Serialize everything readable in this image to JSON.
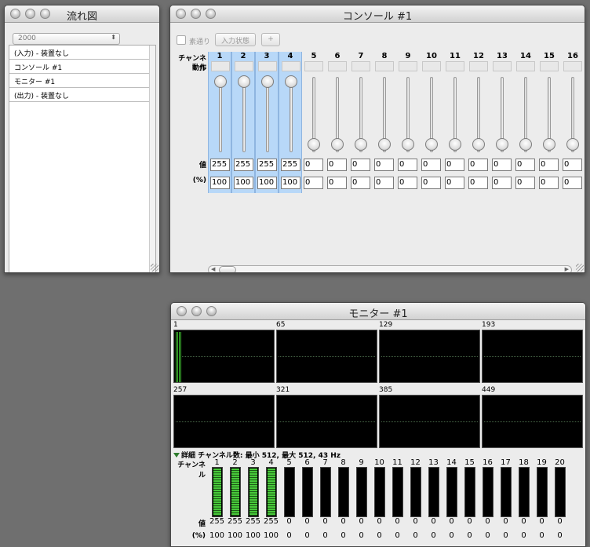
{
  "flow": {
    "title": "流れ図",
    "popup_value": "2000",
    "items": [
      "(入力) - 装置なし",
      "コンソール #1",
      "モニター #1",
      "(出力) - 装置なし"
    ]
  },
  "console": {
    "title": "コンソール #1",
    "bypass_label": "素通り",
    "input_state_button": "入力状態",
    "add_button": "+",
    "channel_label": "チャンネル",
    "action_label": "動作",
    "value_label": "値",
    "percent_label": "(%)",
    "channels": [
      {
        "num": "1",
        "value": "255",
        "percent": "100",
        "selected": true,
        "level": 1
      },
      {
        "num": "2",
        "value": "255",
        "percent": "100",
        "selected": true,
        "level": 1
      },
      {
        "num": "3",
        "value": "255",
        "percent": "100",
        "selected": true,
        "level": 1
      },
      {
        "num": "4",
        "value": "255",
        "percent": "100",
        "selected": true,
        "level": 1
      },
      {
        "num": "5",
        "value": "0",
        "percent": "0",
        "selected": false,
        "level": 0
      },
      {
        "num": "6",
        "value": "0",
        "percent": "0",
        "selected": false,
        "level": 0
      },
      {
        "num": "7",
        "value": "0",
        "percent": "0",
        "selected": false,
        "level": 0
      },
      {
        "num": "8",
        "value": "0",
        "percent": "0",
        "selected": false,
        "level": 0
      },
      {
        "num": "9",
        "value": "0",
        "percent": "0",
        "selected": false,
        "level": 0
      },
      {
        "num": "10",
        "value": "0",
        "percent": "0",
        "selected": false,
        "level": 0
      },
      {
        "num": "11",
        "value": "0",
        "percent": "0",
        "selected": false,
        "level": 0
      },
      {
        "num": "12",
        "value": "0",
        "percent": "0",
        "selected": false,
        "level": 0
      },
      {
        "num": "13",
        "value": "0",
        "percent": "0",
        "selected": false,
        "level": 0
      },
      {
        "num": "14",
        "value": "0",
        "percent": "0",
        "selected": false,
        "level": 0
      },
      {
        "num": "15",
        "value": "0",
        "percent": "0",
        "selected": false,
        "level": 0
      },
      {
        "num": "16",
        "value": "0",
        "percent": "0",
        "selected": false,
        "level": 0
      }
    ]
  },
  "monitor": {
    "title": "モニター #1",
    "graph_labels": [
      "1",
      "65",
      "129",
      "193",
      "257",
      "321",
      "385",
      "449"
    ],
    "detail_label": "詳細",
    "info_text": "チャンネル数: 最小 512, 最大 512, 43 Hz",
    "channel_label": "チャンネル",
    "value_label": "値",
    "percent_label": "(%)",
    "channels": [
      {
        "num": "1",
        "value": "255",
        "percent": "100",
        "level": 1
      },
      {
        "num": "2",
        "value": "255",
        "percent": "100",
        "level": 1
      },
      {
        "num": "3",
        "value": "255",
        "percent": "100",
        "level": 1
      },
      {
        "num": "4",
        "value": "255",
        "percent": "100",
        "level": 1
      },
      {
        "num": "5",
        "value": "0",
        "percent": "0",
        "level": 0
      },
      {
        "num": "6",
        "value": "0",
        "percent": "0",
        "level": 0
      },
      {
        "num": "7",
        "value": "0",
        "percent": "0",
        "level": 0
      },
      {
        "num": "8",
        "value": "0",
        "percent": "0",
        "level": 0
      },
      {
        "num": "9",
        "value": "0",
        "percent": "0",
        "level": 0
      },
      {
        "num": "10",
        "value": "0",
        "percent": "0",
        "level": 0
      },
      {
        "num": "11",
        "value": "0",
        "percent": "0",
        "level": 0
      },
      {
        "num": "12",
        "value": "0",
        "percent": "0",
        "level": 0
      },
      {
        "num": "13",
        "value": "0",
        "percent": "0",
        "level": 0
      },
      {
        "num": "14",
        "value": "0",
        "percent": "0",
        "level": 0
      },
      {
        "num": "15",
        "value": "0",
        "percent": "0",
        "level": 0
      },
      {
        "num": "16",
        "value": "0",
        "percent": "0",
        "level": 0
      },
      {
        "num": "17",
        "value": "0",
        "percent": "0",
        "level": 0
      },
      {
        "num": "18",
        "value": "0",
        "percent": "0",
        "level": 0
      },
      {
        "num": "19",
        "value": "0",
        "percent": "0",
        "level": 0
      },
      {
        "num": "20",
        "value": "0",
        "percent": "0",
        "level": 0
      }
    ]
  }
}
